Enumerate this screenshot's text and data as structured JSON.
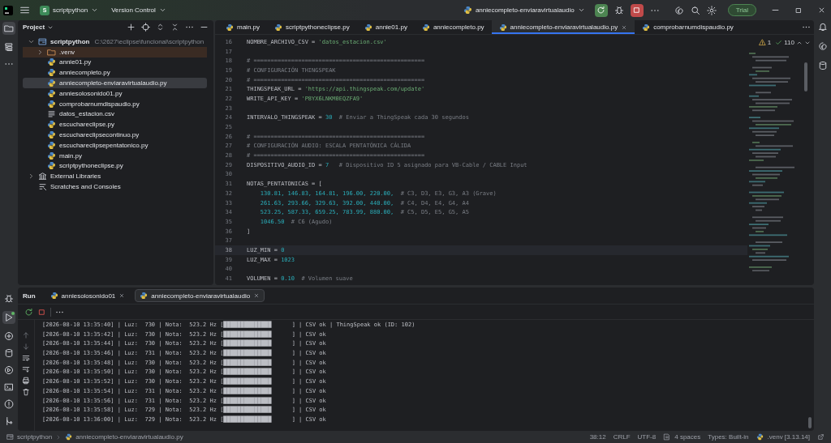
{
  "title_bar": {
    "project_badge": "S",
    "project": "scriptpython",
    "vcs": "Version Control",
    "run_config": "anniecompleto-enviaravirtualaudio",
    "trial": "Trial"
  },
  "project_panel": {
    "title": "Project",
    "tree": [
      {
        "name": "scriptpython",
        "path": "C:\\2627\\eclipse\\funcional\\scriptpython",
        "kind": "project",
        "expanded": true,
        "selected": false,
        "children": [
          {
            "name": ".venv",
            "kind": "excluded-folder",
            "expanded": false,
            "selected": false
          },
          {
            "name": "annie01.py",
            "kind": "python",
            "selected": false
          },
          {
            "name": "anniecompleto.py",
            "kind": "python",
            "selected": false
          },
          {
            "name": "anniecompleto-enviaravirtualaudio.py",
            "kind": "python",
            "selected": true
          },
          {
            "name": "anniesolosonido01.py",
            "kind": "python",
            "selected": false
          },
          {
            "name": "comprobarnumdispaudio.py",
            "kind": "python",
            "selected": false
          },
          {
            "name": "datos_estacion.csv",
            "kind": "text",
            "selected": false
          },
          {
            "name": "escuchareclipse.py",
            "kind": "python",
            "selected": false
          },
          {
            "name": "escuchareclipsecontinuo.py",
            "kind": "python",
            "selected": false
          },
          {
            "name": "escuchareclipsepentatonico.py",
            "kind": "python",
            "selected": false
          },
          {
            "name": "main.py",
            "kind": "python",
            "selected": false
          },
          {
            "name": "scriptpythoneclipse.py",
            "kind": "python",
            "selected": false
          }
        ]
      },
      {
        "name": "External Libraries",
        "kind": "library",
        "expanded": false,
        "selected": false
      },
      {
        "name": "Scratches and Consoles",
        "kind": "scratches",
        "selected": false
      }
    ]
  },
  "editor": {
    "tabs": [
      {
        "label": "main.py",
        "selected": false
      },
      {
        "label": "scriptpythoneclipse.py",
        "selected": false
      },
      {
        "label": "annie01.py",
        "selected": false
      },
      {
        "label": "anniecompleto.py",
        "selected": false
      },
      {
        "label": "anniecompleto-enviaravirtualaudio.py",
        "selected": true
      },
      {
        "label": "comprobarnumdispaudio.py",
        "selected": false
      }
    ],
    "inspections": {
      "warnings": "1",
      "passed": "110"
    },
    "lines": [
      {
        "number": "16",
        "current": false,
        "tokens": [
          {
            "text": "NOMBRE_ARCHIVO_CSV = ",
            "kind": "plain"
          },
          {
            "text": "'datos_estacion.csv'",
            "kind": "string"
          }
        ]
      },
      {
        "number": "17",
        "current": false
      },
      {
        "number": "18",
        "current": false,
        "tokens": [
          {
            "text": "# ==================================================",
            "kind": "comment"
          }
        ]
      },
      {
        "number": "19",
        "current": false,
        "tokens": [
          {
            "text": "# CONFIGURACIÓN THINGSPEAK",
            "kind": "comment"
          }
        ]
      },
      {
        "number": "20",
        "current": false,
        "tokens": [
          {
            "text": "# ==================================================",
            "kind": "comment"
          }
        ]
      },
      {
        "number": "21",
        "current": false,
        "tokens": [
          {
            "text": "THINGSPEAK_URL = ",
            "kind": "plain"
          },
          {
            "text": "'https://api.thingspeak.com/update'",
            "kind": "string"
          }
        ]
      },
      {
        "number": "22",
        "current": false,
        "tokens": [
          {
            "text": "WRITE_API_KEY = ",
            "kind": "plain"
          },
          {
            "text": "'P8YX6LNKM0EQZFA9'",
            "kind": "string"
          }
        ]
      },
      {
        "number": "23",
        "current": false
      },
      {
        "number": "24",
        "current": false,
        "tokens": [
          {
            "text": "INTERVALO_THINGSPEAK = ",
            "kind": "plain"
          },
          {
            "text": "30",
            "kind": "number"
          },
          {
            "text": "  # Enviar a ThingSpeak cada 30 segundos",
            "kind": "comment"
          }
        ]
      },
      {
        "number": "25",
        "current": false
      },
      {
        "number": "26",
        "current": false,
        "tokens": [
          {
            "text": "# ==================================================",
            "kind": "comment"
          }
        ]
      },
      {
        "number": "27",
        "current": false,
        "tokens": [
          {
            "text": "# CONFIGURACIÓN AUDIO: ESCALA PENTATÓNICA CÁLIDA",
            "kind": "comment"
          }
        ]
      },
      {
        "number": "28",
        "current": false,
        "tokens": [
          {
            "text": "# ==================================================",
            "kind": "comment"
          }
        ]
      },
      {
        "number": "29",
        "current": false,
        "tokens": [
          {
            "text": "DISPOSITIVO_AUDIO_ID = ",
            "kind": "plain"
          },
          {
            "text": "7",
            "kind": "number"
          },
          {
            "text": "   # Dispositivo ID 5 asignado para VB-Cable / CABLE Input",
            "kind": "comment"
          }
        ]
      },
      {
        "number": "30",
        "current": false
      },
      {
        "number": "31",
        "current": false,
        "tokens": [
          {
            "text": "NOTAS_PENTATONICAS = [",
            "kind": "plain"
          }
        ]
      },
      {
        "number": "32",
        "current": false,
        "tokens": [
          {
            "text": "    130.81, 146.83, 164.81, 196.00, 220.00,",
            "kind": "number"
          },
          {
            "text": "  # C3, D3, E3, G3, A3 (Grave)",
            "kind": "comment"
          }
        ]
      },
      {
        "number": "33",
        "current": false,
        "tokens": [
          {
            "text": "    261.63, 293.66, 329.63, 392.00, 440.00,",
            "kind": "number"
          },
          {
            "text": "  # C4, D4, E4, G4, A4",
            "kind": "comment"
          }
        ]
      },
      {
        "number": "34",
        "current": false,
        "tokens": [
          {
            "text": "    523.25, 587.33, 659.25, 783.99, 880.00,",
            "kind": "number"
          },
          {
            "text": "  # C5, D5, E5, G5, A5",
            "kind": "comment"
          }
        ]
      },
      {
        "number": "35",
        "current": false,
        "tokens": [
          {
            "text": "    1046.50",
            "kind": "number"
          },
          {
            "text": "  # C6 (Agudo)",
            "kind": "comment"
          }
        ]
      },
      {
        "number": "36",
        "current": false,
        "tokens": [
          {
            "text": "]",
            "kind": "plain"
          }
        ]
      },
      {
        "number": "37",
        "current": false
      },
      {
        "number": "38",
        "current": true,
        "tokens": [
          {
            "text": "LUZ_MIN = ",
            "kind": "plain"
          },
          {
            "text": "0",
            "kind": "number"
          }
        ]
      },
      {
        "number": "39",
        "current": false,
        "tokens": [
          {
            "text": "LUZ_MAX = ",
            "kind": "plain"
          },
          {
            "text": "1023",
            "kind": "number"
          }
        ]
      },
      {
        "number": "40",
        "current": false
      },
      {
        "number": "41",
        "current": false,
        "tokens": [
          {
            "text": "VOLUMEN = ",
            "kind": "plain"
          },
          {
            "text": "0.10",
            "kind": "number"
          },
          {
            "text": "  # Volumen suave",
            "kind": "comment"
          }
        ]
      }
    ]
  },
  "run_panel": {
    "title": "Run",
    "tabs": [
      {
        "label": "anniesolosonido01",
        "selected": false
      },
      {
        "label": "anniecompleto-enviaravirtualaudio",
        "selected": true
      }
    ],
    "output": [
      "[2026-08-10 13:35:40] | Luz:  730 | Nota:  523.2 Hz [██████████████      ] | CSV ok | ThingSpeak ok (ID: 102)",
      "[2026-08-10 13:35:42] | Luz:  730 | Nota:  523.2 Hz [██████████████      ] | CSV ok",
      "[2026-08-10 13:35:44] | Luz:  730 | Nota:  523.2 Hz [██████████████      ] | CSV ok",
      "[2026-08-10 13:35:46] | Luz:  731 | Nota:  523.2 Hz [██████████████      ] | CSV ok",
      "[2026-08-10 13:35:48] | Luz:  730 | Nota:  523.2 Hz [██████████████      ] | CSV ok",
      "[2026-08-10 13:35:50] | Luz:  730 | Nota:  523.2 Hz [██████████████      ] | CSV ok",
      "[2026-08-10 13:35:52] | Luz:  730 | Nota:  523.2 Hz [██████████████      ] | CSV ok",
      "[2026-08-10 13:35:54] | Luz:  731 | Nota:  523.2 Hz [██████████████      ] | CSV ok",
      "[2026-08-10 13:35:56] | Luz:  731 | Nota:  523.2 Hz [██████████████      ] | CSV ok",
      "[2026-08-10 13:35:58] | Luz:  729 | Nota:  523.2 Hz [██████████████      ] | CSV ok",
      "[2026-08-10 13:36:00] | Luz:  729 | Nota:  523.2 Hz [██████████████      ] | CSV ok"
    ]
  },
  "status_bar": {
    "breadcrumb": [
      "scriptpython",
      "anniecompleto-enviaravirtualaudio.py"
    ],
    "items": [
      {
        "text": "38:12",
        "kind": "position"
      },
      {
        "text": "CRLF",
        "kind": "line-separator"
      },
      {
        "text": "UTF-8",
        "kind": "encoding"
      },
      {
        "text": "4 spaces",
        "kind": "indent"
      },
      {
        "text": "Types: Built-in",
        "kind": "types"
      },
      {
        "text": ".venv [3.13.14]",
        "kind": "interpreter"
      }
    ]
  }
}
